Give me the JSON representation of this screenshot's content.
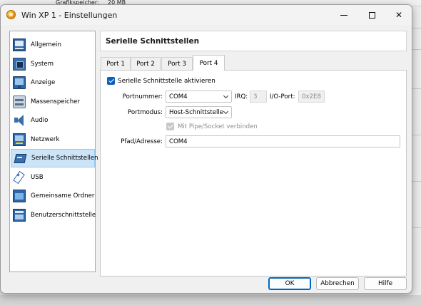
{
  "background": {
    "text_left": "Grafikspeicher:",
    "text_right": "20 MB"
  },
  "window": {
    "title": "Win XP 1 - Einstellungen",
    "min_glyph": "minimize",
    "max_glyph": "maximize",
    "close_glyph": "✕"
  },
  "sidebar": {
    "items": [
      {
        "label": "Allgemein",
        "icon": "general-icon"
      },
      {
        "label": "System",
        "icon": "system-icon"
      },
      {
        "label": "Anzeige",
        "icon": "display-icon"
      },
      {
        "label": "Massenspeicher",
        "icon": "storage-icon"
      },
      {
        "label": "Audio",
        "icon": "audio-icon"
      },
      {
        "label": "Netzwerk",
        "icon": "network-icon"
      },
      {
        "label": "Serielle Schnittstellen",
        "icon": "serial-icon",
        "selected": true
      },
      {
        "label": "USB",
        "icon": "usb-icon"
      },
      {
        "label": "Gemeinsame Ordner",
        "icon": "shared-folder-icon"
      },
      {
        "label": "Benutzerschnittstelle",
        "icon": "user-interface-icon"
      }
    ]
  },
  "panel": {
    "title": "Serielle Schnittstellen",
    "tabs": [
      {
        "label": "Port 1"
      },
      {
        "label": "Port 2"
      },
      {
        "label": "Port 3"
      },
      {
        "label": "Port 4",
        "active": true
      }
    ]
  },
  "port": {
    "enable_label": "Serielle Schnittstelle aktivieren",
    "enable_checked": true,
    "port_number_label": "Portnummer:",
    "port_number_value": "COM4",
    "irq_label": "IRQ:",
    "irq_value": "3",
    "io_port_label": "I/O-Port:",
    "io_port_value": "0x2E8",
    "port_mode_label": "Portmodus:",
    "port_mode_value": "Host-Schnittstelle",
    "pipe_label": "Mit Pipe/Socket verbinden",
    "pipe_checked": true,
    "pipe_disabled": true,
    "path_label": "Pfad/Adresse:",
    "path_value": "COM4"
  },
  "footer": {
    "ok_label": "OK",
    "cancel_label": "Abbrechen",
    "help_label": "Hilfe"
  },
  "colors": {
    "accent": "#0067c0",
    "selection": "#cce4f7",
    "checkbox": "#0a5fc2"
  }
}
